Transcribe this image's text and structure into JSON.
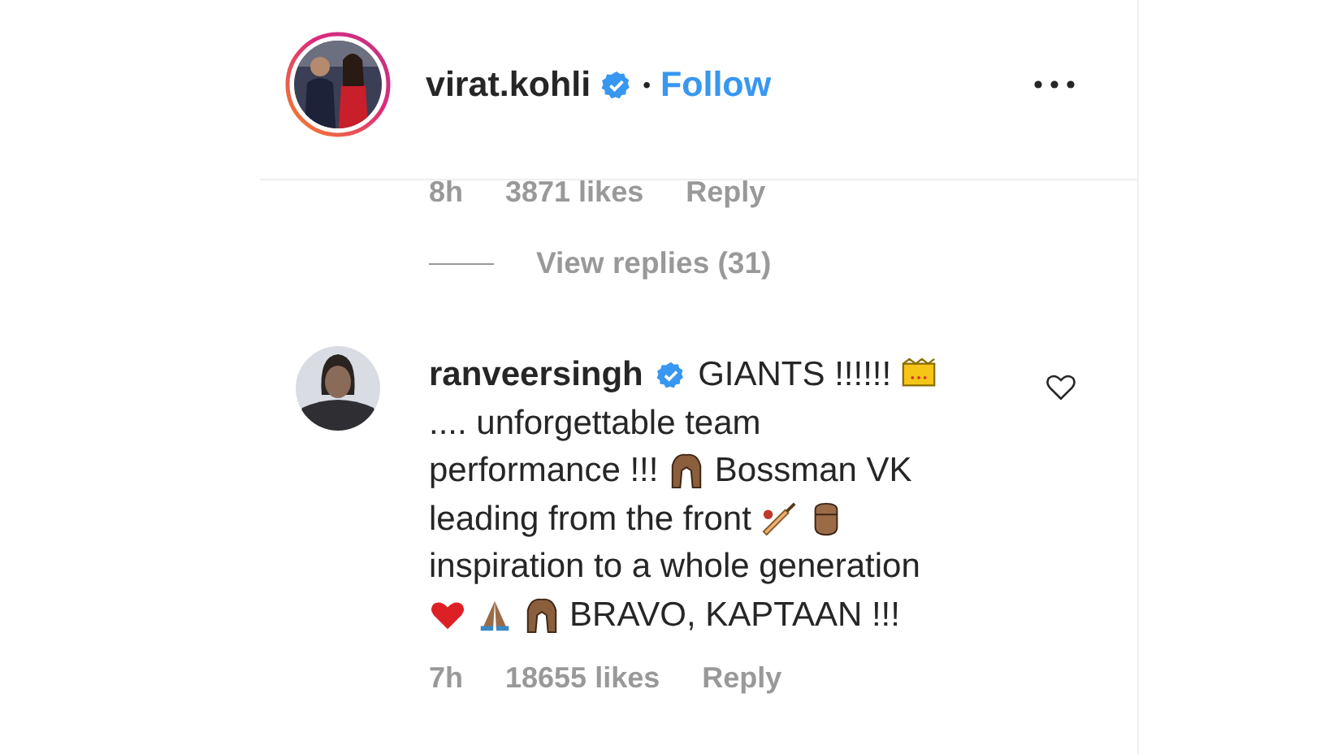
{
  "post_header": {
    "username": "virat.kohli",
    "verified": true,
    "separator": "•",
    "follow": "Follow"
  },
  "previous_comment_meta": {
    "time": "8h",
    "likes": "3871 likes",
    "reply": "Reply"
  },
  "view_replies": "View replies (31)",
  "comment": {
    "username": "ranveersingh",
    "verified": true,
    "liked": false,
    "parts": [
      {
        "kind": "text",
        "text": "GIANTS !!!!!!"
      },
      {
        "kind": "crown"
      },
      {
        "kind": "text",
        "text": ".... unforgettable team"
      },
      {
        "kind": "text",
        "text": "performance !!!"
      },
      {
        "kind": "hands"
      },
      {
        "kind": "text",
        "text": "Bossman VK"
      },
      {
        "kind": "text",
        "text": "leading from the front"
      },
      {
        "kind": "bat"
      },
      {
        "kind": "fist"
      },
      {
        "kind": "text",
        "text": "inspiration to a whole generation"
      },
      {
        "kind": "heart"
      },
      {
        "kind": "pray"
      },
      {
        "kind": "hands"
      },
      {
        "kind": "text",
        "text": "BRAVO, KAPTAAN !!!"
      }
    ],
    "time": "7h",
    "likes": "18655 likes",
    "reply": "Reply"
  }
}
